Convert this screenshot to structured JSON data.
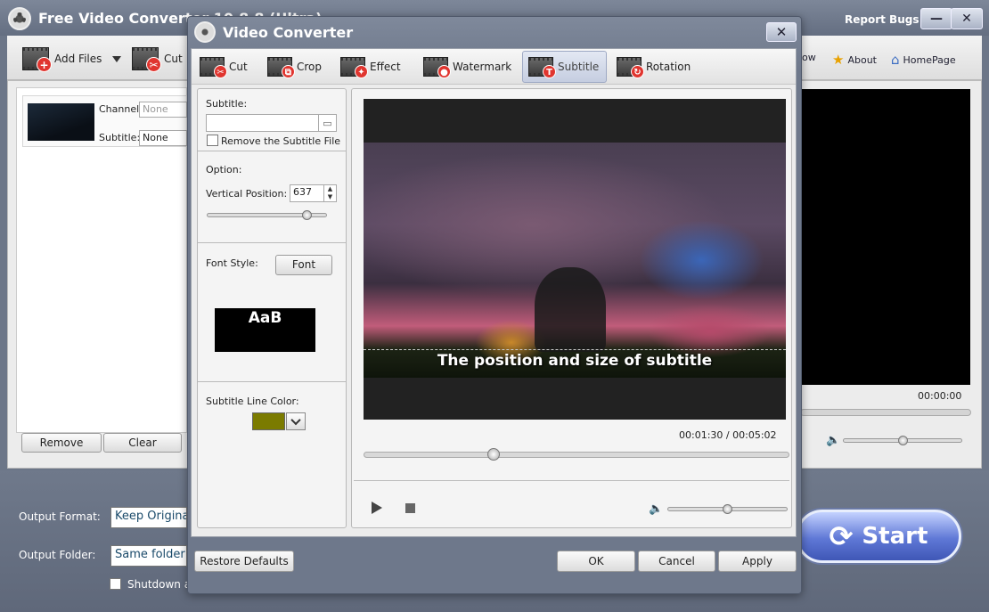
{
  "main": {
    "title": "Free Video Converter 10.8.8 (Ultra)",
    "report_bugs": "Report Bugs",
    "minimize": "—",
    "close": "✕",
    "toolbar": {
      "add_files": "Add Files",
      "cut": "Cut",
      "now_partial": "ow",
      "about": "About",
      "homepage": "HomePage"
    },
    "file_item": {
      "channel_label": "Channel:",
      "channel_value": "None",
      "subtitle_label": "Subtitle:",
      "subtitle_value": "None"
    },
    "remove": "Remove",
    "clear": "Clear",
    "right_time": "00:00:00",
    "output_format_label": "Output Format:",
    "output_format_value": "Keep Original",
    "output_folder_label": "Output Folder:",
    "output_folder_value": "Same folder a",
    "shutdown_label": "Shutdown a",
    "start": "Start"
  },
  "dialog": {
    "title": "Video Converter",
    "close": "✕",
    "tabs": [
      {
        "label": "Cut",
        "icon": "scissors-icon"
      },
      {
        "label": "Crop",
        "icon": "crop-icon"
      },
      {
        "label": "Effect",
        "icon": "wand-icon"
      },
      {
        "label": "Watermark",
        "icon": "drop-icon"
      },
      {
        "label": "Subtitle",
        "icon": "text-icon",
        "active": true
      },
      {
        "label": "Rotation",
        "icon": "rotate-icon"
      }
    ],
    "subtitle_label": "Subtitle:",
    "subtitle_file_value": "",
    "remove_subtitle_label": "Remove the Subtitle File",
    "option_label": "Option:",
    "vertical_position_label": "Vertical Position:",
    "vertical_position_value": "637",
    "vertical_position_slider": 0.86,
    "font_style_label": "Font Style:",
    "font_button": "Font",
    "font_preview": "AaB",
    "line_color_label": "Subtitle Line Color:",
    "line_color": "#7b7b00",
    "subtitle_preview_text": "The position and size of subtitle",
    "current_time": "00:01:30",
    "time_sep": "/",
    "total_time": "00:05:02",
    "seek_fraction": 0.3,
    "volume_fraction": 0.5,
    "restore_defaults": "Restore Defaults",
    "ok": "OK",
    "cancel": "Cancel",
    "apply": "Apply"
  }
}
